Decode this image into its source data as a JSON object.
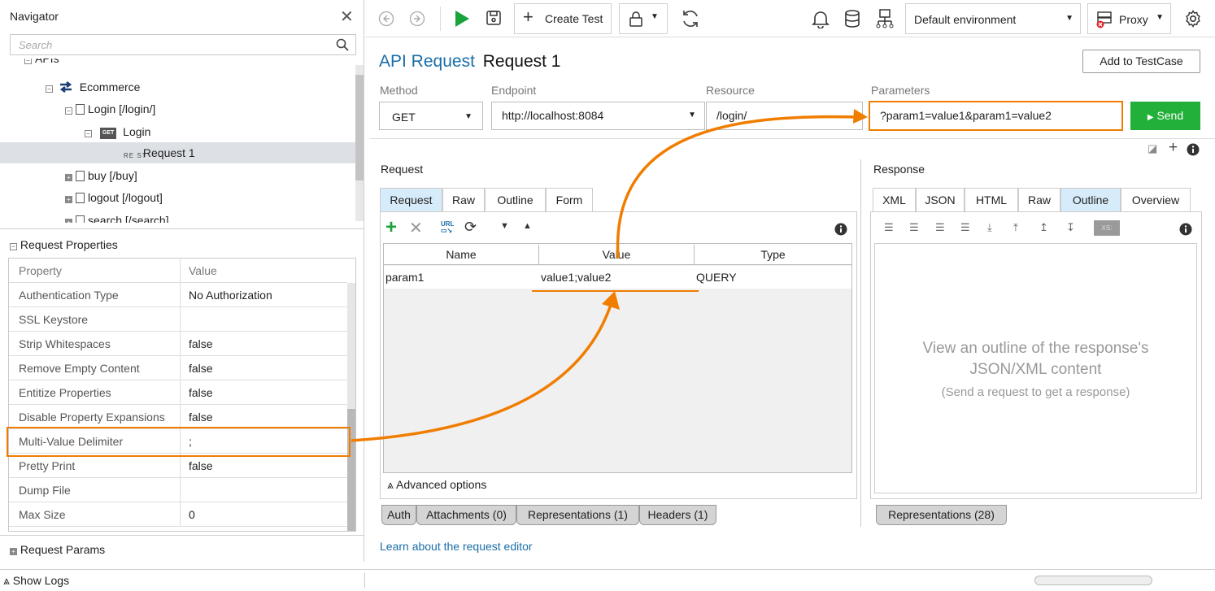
{
  "navigator": {
    "title": "Navigator",
    "search_placeholder": "Search",
    "tree": [
      {
        "label": "APIs"
      },
      {
        "label": "Ecommerce"
      },
      {
        "label": "Login [/login/]"
      },
      {
        "label": "Login",
        "badge": "GET"
      },
      {
        "label": "Request 1",
        "badge": "RE ST"
      },
      {
        "label": "buy [/buy]"
      },
      {
        "label": "logout [/logout]"
      },
      {
        "label": "search [/search]"
      }
    ]
  },
  "request_properties": {
    "title": "Request Properties",
    "col_property": "Property",
    "col_value": "Value",
    "rows": [
      {
        "name": "Authentication Type",
        "value": "No Authorization"
      },
      {
        "name": "SSL Keystore",
        "value": ""
      },
      {
        "name": "Strip Whitespaces",
        "value": "false"
      },
      {
        "name": "Remove Empty Content",
        "value": "false"
      },
      {
        "name": "Entitize Properties",
        "value": "false"
      },
      {
        "name": "Disable Property Expansions",
        "value": "false"
      },
      {
        "name": "Multi-Value Delimiter",
        "value": ";"
      },
      {
        "name": "Pretty Print",
        "value": "false"
      },
      {
        "name": "Dump File",
        "value": ""
      },
      {
        "name": "Max Size",
        "value": "0"
      }
    ]
  },
  "request_params_label": "Request Params",
  "show_logs_label": "Show Logs",
  "toolbar": {
    "create_test": "Create Test",
    "environment": "Default environment",
    "proxy": "Proxy"
  },
  "header": {
    "type": "API Request",
    "name": "Request 1",
    "add_to_testcase": "Add to TestCase"
  },
  "fields": {
    "method_label": "Method",
    "method": "GET",
    "endpoint_label": "Endpoint",
    "endpoint": "http://localhost:8084",
    "resource_label": "Resource",
    "resource": "/login/",
    "parameters_label": "Parameters",
    "parameters": "?param1=value1&param1=value2",
    "send": "Send"
  },
  "request": {
    "title": "Request",
    "tabs": [
      "Request",
      "Raw",
      "Outline",
      "Form"
    ],
    "columns": [
      "Name",
      "Value",
      "Type"
    ],
    "rows": [
      {
        "name": "param1",
        "value": "value1;value2",
        "type": "QUERY"
      }
    ],
    "advanced": "Advanced options",
    "bottom_tabs": [
      "Auth",
      "Attachments (0)",
      "Representations (1)",
      "Headers (1)"
    ],
    "learn_link": "Learn about the request editor"
  },
  "response": {
    "title": "Response",
    "tabs": [
      "XML",
      "JSON",
      "HTML",
      "Raw",
      "Outline",
      "Overview"
    ],
    "placeholder_line1": "View an outline of the response's",
    "placeholder_line2": "JSON/XML content",
    "placeholder_hint": "(Send a request to get a response)",
    "bottom_tab": "Representations (28)"
  },
  "colors": {
    "accent_orange": "#f07d00",
    "send_green": "#22b03a",
    "run_green": "#1aa33a",
    "title_blue": "#1a6ea8",
    "active_tab": "#d7ecfa"
  }
}
